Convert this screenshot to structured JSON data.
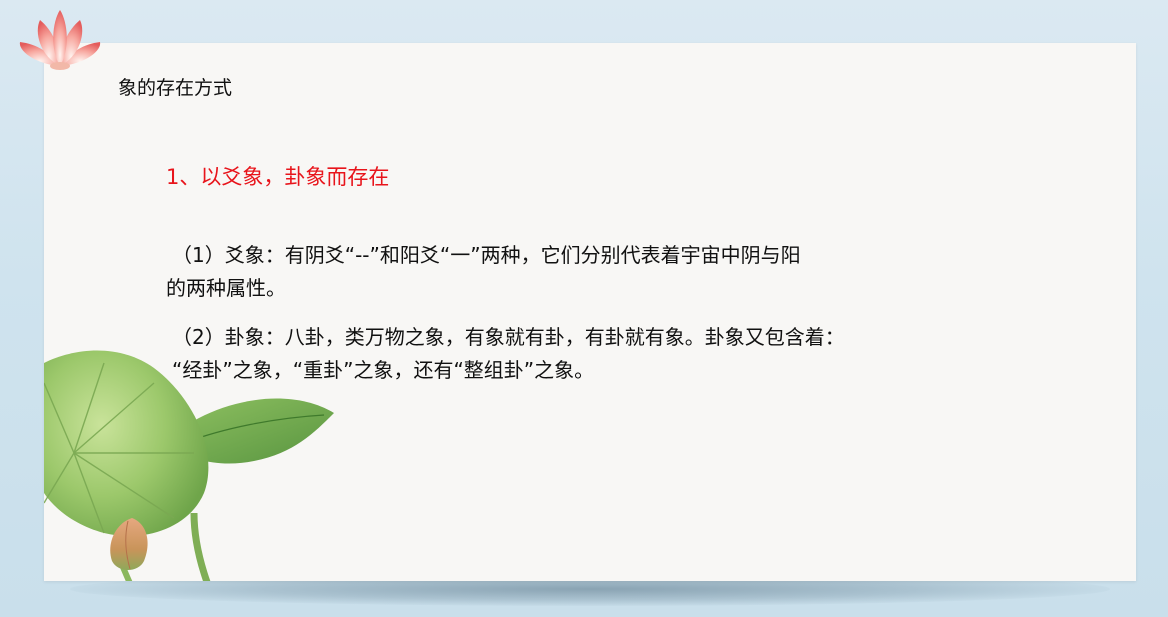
{
  "slide": {
    "title": "象的存在方式",
    "heading": "1、以爻象，卦象而存在",
    "para1_line1": "（1）爻象：有阴爻“--”和阳爻“一”两种，它们分别代表着宇宙中阴与阳",
    "para1_line2": "的两种属性。",
    "para2_line1": "（2）卦象：八卦，类万物之象，有象就有卦，有卦就有象。卦象又包含着：",
    "para2_line2": "“经卦”之象，“重卦”之象，还有“整组卦”之象。"
  },
  "decor": {
    "corner_icon": "lotus-flower-icon",
    "leaf_icon": "lotus-leaf-icon",
    "colors": {
      "heading": "#e8141b",
      "text": "#111111",
      "background": "#d6e7f1",
      "slide": "#f8f7f5"
    }
  }
}
